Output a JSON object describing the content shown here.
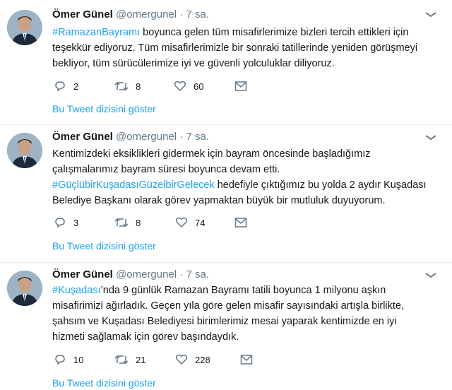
{
  "tweets": [
    {
      "name": "Ömer Günel",
      "handle": "@omergunel",
      "dot": "·",
      "time": "7 sa.",
      "hashtag": "#RamazanBayramı",
      "text_after_hashtag": " boyunca gelen tüm misafirlerimize bizleri tercih ettikleri için",
      "lines": [
        "teşekkür ediyoruz. Tüm misafirlerimizle bir sonraki tatillerinde yeniden görüşmeyi",
        "bekliyor, tüm sürücülerimize iyi ve güvenli yolculuklar diliyoruz."
      ],
      "replies": "2",
      "retweets": "8",
      "likes": "60",
      "thread_link": "Bu Tweet dizisini göster"
    },
    {
      "name": "Ömer Günel",
      "handle": "@omergunel",
      "dot": "·",
      "time": "7 sa.",
      "line1": "Kentimizdeki eksiklikleri gidermek için bayram öncesinde başladığımız",
      "line2": "çalışmalarımız bayram süresi boyunca devam etti.",
      "hashtag": "#GüçlübirKuşadasıGüzelbirGelecek",
      "text_after_hashtag": " hedefiyle çıktığımız bu yolda 2 aydır Kuşadası",
      "line4": "Belediye Başkanı olarak görev yapmaktan büyük bir mutluluk duyuyorum.",
      "replies": "3",
      "retweets": "8",
      "likes": "74",
      "thread_link": "Bu Tweet dizisini göster"
    },
    {
      "name": "Ömer Günel",
      "handle": "@omergunel",
      "dot": "·",
      "time": "7 sa.",
      "hashtag": "#Kuşadası",
      "text_after_hashtag": "’nda 9 günlük Ramazan Bayramı tatili boyunca 1 milyonu aşkın",
      "lines": [
        "misafirimizi ağırladık. Geçen yıla göre gelen misafir sayısındaki artışla birlikte,",
        "şahsım ve Kuşadası Belediyesi birimlerimiz mesai yaparak kentimizde en iyi",
        "hizmeti sağlamak için görev başındaydık."
      ],
      "replies": "10",
      "retweets": "21",
      "likes": "228",
      "thread_link": "Bu Tweet dizisini göster"
    }
  ],
  "colors": {
    "link": "#1da1f2",
    "secondary_text": "#657786",
    "separator": "#e6ecf0"
  },
  "icons": [
    "chevron-down-icon",
    "reply-icon",
    "retweet-icon",
    "like-icon",
    "direct-message-icon"
  ]
}
